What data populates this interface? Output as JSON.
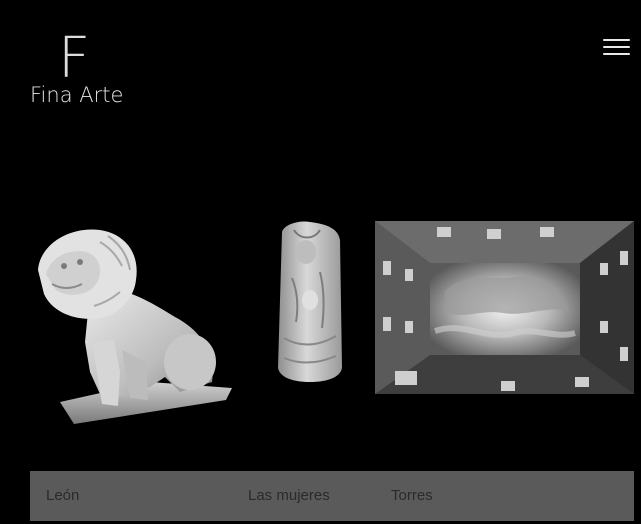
{
  "brand": {
    "logo_letter": "F",
    "name": "Fina Arte"
  },
  "header": {
    "menu_icon": "hamburger-menu-icon"
  },
  "gallery": {
    "items": [
      {
        "id": "leon",
        "caption": "León",
        "image": "lion-sculpture"
      },
      {
        "id": "mujeres",
        "caption": "Las mujeres",
        "image": "female-figure-column-sculpture"
      },
      {
        "id": "torres",
        "caption": "Torres",
        "image": "courtyard-sky-photo"
      }
    ]
  },
  "colors": {
    "background": "#000000",
    "caption_bar": "#5a5a5a",
    "caption_text": "#2a2a2a",
    "logo_text": "#e6e6e6"
  }
}
